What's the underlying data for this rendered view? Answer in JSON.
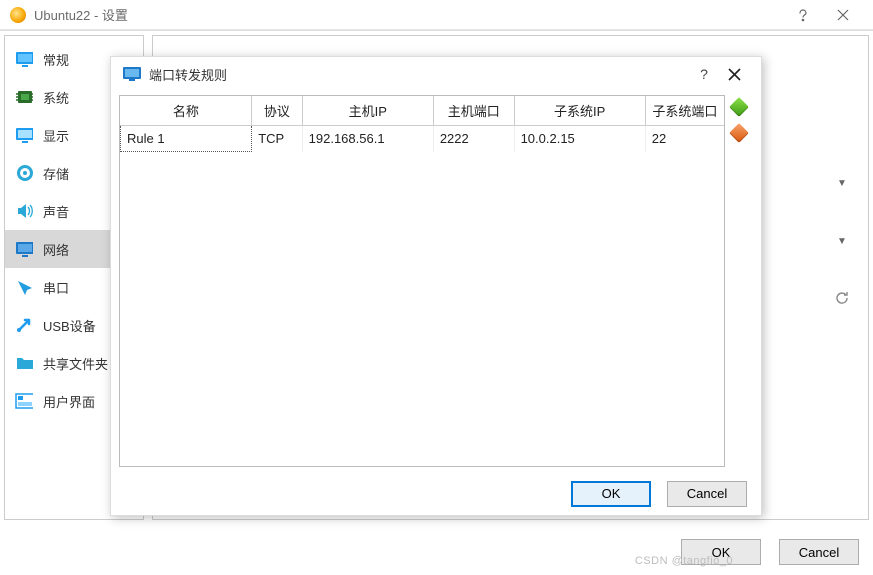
{
  "window": {
    "title": "Ubuntu22 - 设置"
  },
  "sidebar": {
    "items": [
      {
        "label": "常规"
      },
      {
        "label": "系统"
      },
      {
        "label": "显示"
      },
      {
        "label": "存储"
      },
      {
        "label": "声音"
      },
      {
        "label": "网络"
      },
      {
        "label": "串口"
      },
      {
        "label": "USB设备"
      },
      {
        "label": "共享文件夹"
      },
      {
        "label": "用户界面"
      }
    ],
    "active_index": 5
  },
  "main_footer": {
    "ok": "OK",
    "cancel": "Cancel"
  },
  "dialog": {
    "title": "端口转发规则",
    "help": "?",
    "columns": [
      "名称",
      "协议",
      "主机IP",
      "主机端口",
      "子系统IP",
      "子系统端口"
    ],
    "rows": [
      {
        "name": "Rule 1",
        "protocol": "TCP",
        "host_ip": "192.168.56.1",
        "host_port": "2222",
        "guest_ip": "10.0.2.15",
        "guest_port": "22"
      }
    ],
    "footer": {
      "ok": "OK",
      "cancel": "Cancel"
    }
  },
  "watermark": "CSDN @tangfio_0"
}
